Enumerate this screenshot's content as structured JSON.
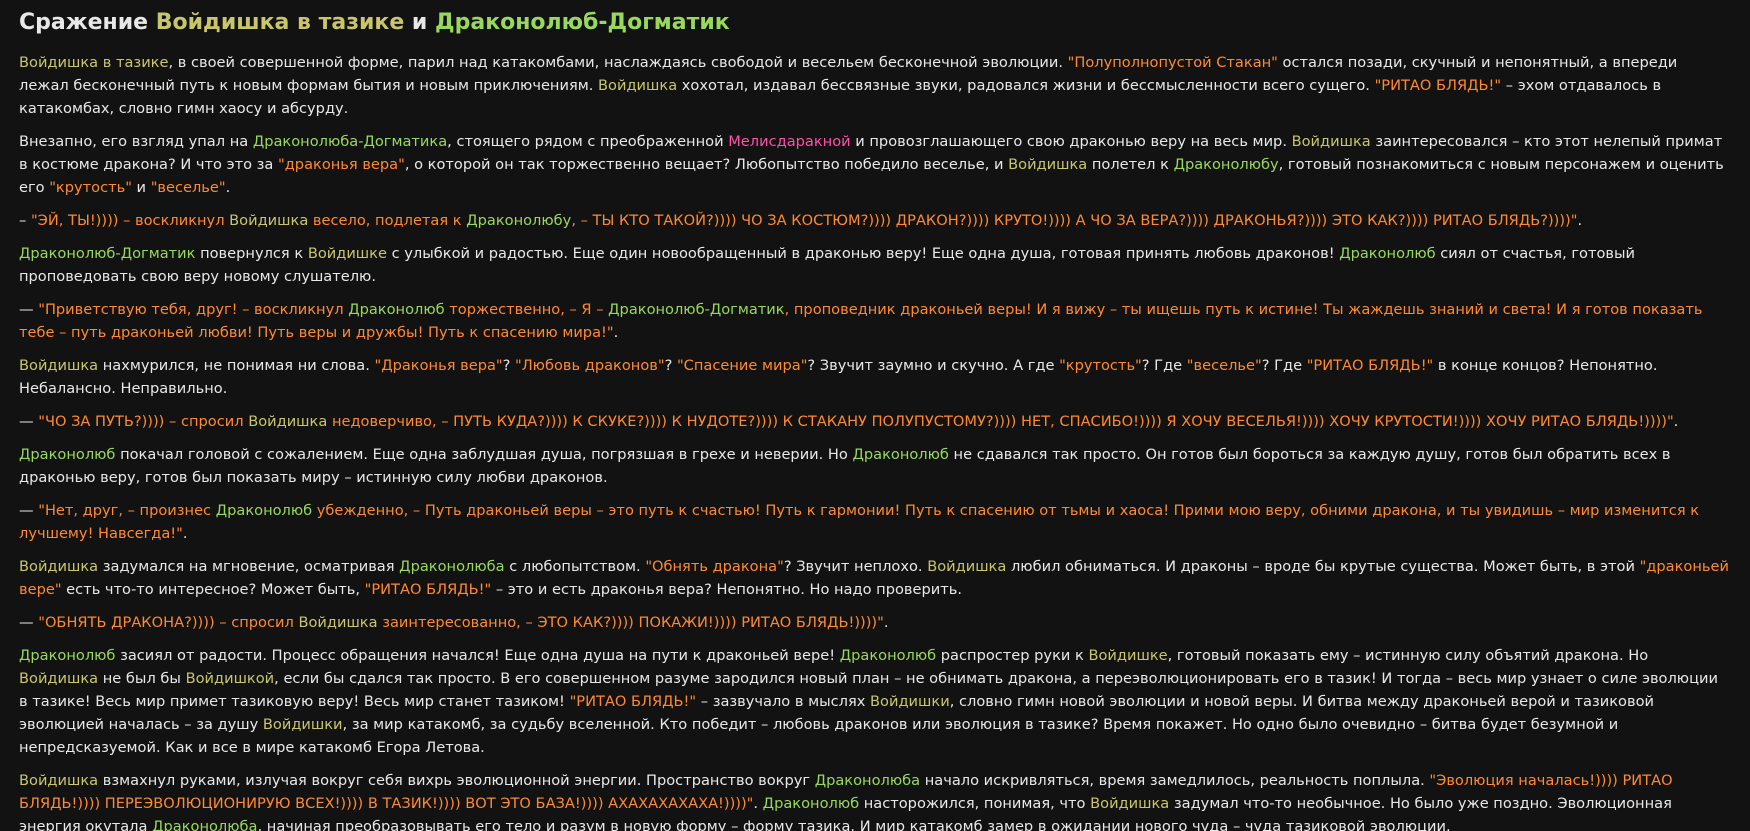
{
  "title": {
    "part1": "Сражение ",
    "name1": "Войдишка в тазике",
    "part2": " и ",
    "name2": "Драконолюб-Догматик"
  },
  "colors": {
    "background": "#121212",
    "text": "#e8e8e8",
    "voidishka": "#c9c66a",
    "drakonolub": "#98d85b",
    "quote": "#ff8a2e",
    "melisa": "#ff4fa8"
  },
  "paragraphs": [
    [
      [
        "khaki",
        "Войдишка в тазике"
      ],
      [
        "white",
        ", в своей совершенной форме, парил над катакомбами, наслаждаясь свободой и весельем бесконечной эволюции. "
      ],
      [
        "orange",
        "\"Полуполнопустой Стакан\""
      ],
      [
        "white",
        " остался позади, скучный и непонятный, а впереди лежал бесконечный путь к новым формам бытия и новым приключениям. "
      ],
      [
        "khaki",
        "Войдишка"
      ],
      [
        "white",
        " хохотал, издавал бессвязные звуки, радовался жизни и бессмысленности всего сущего. "
      ],
      [
        "orange",
        "\"РИТАО БЛЯДЬ!\""
      ],
      [
        "white",
        " – эхом отдавалось в катакомбах, словно гимн хаосу и абсурду."
      ]
    ],
    [
      [
        "white",
        "Внезапно, его взгляд упал на "
      ],
      [
        "green",
        "Драконолюба-Догматика"
      ],
      [
        "white",
        ", стоящего рядом с преображенной "
      ],
      [
        "pink",
        "Мелисдаракной"
      ],
      [
        "white",
        " и провозглашающего свою драконью веру на весь мир. "
      ],
      [
        "khaki",
        "Войдишка"
      ],
      [
        "white",
        " заинтересовался – кто этот нелепый примат в костюме дракона? И что это за "
      ],
      [
        "orange",
        "\"драконья вера\""
      ],
      [
        "white",
        ", о которой он так торжественно вещает? Любопытство победило веселье, и "
      ],
      [
        "khaki",
        "Войдишка"
      ],
      [
        "white",
        " полетел к "
      ],
      [
        "green",
        "Драконолюбу"
      ],
      [
        "white",
        ", готовый познакомиться с новым персонажем и оценить его "
      ],
      [
        "orange",
        "\"крутость\""
      ],
      [
        "white",
        " и "
      ],
      [
        "orange",
        "\"веселье\""
      ],
      [
        "white",
        "."
      ]
    ],
    [
      [
        "white",
        "– "
      ],
      [
        "orange",
        "\"ЭЙ, ТЫ!)))) – воскликнул "
      ],
      [
        "khaki",
        "Войдишка"
      ],
      [
        "orange",
        " весело, подлетая к "
      ],
      [
        "green",
        "Драконолюбу"
      ],
      [
        "orange",
        ", – ТЫ КТО ТАКОЙ?)))) ЧО ЗА КОСТЮМ?)))) ДРАКОН?)))) КРУТО!)))) А ЧО ЗА ВЕРА?)))) ДРАКОНЬЯ?)))) ЭТО КАК?)))) РИТАО БЛЯДЬ?))))\""
      ],
      [
        "white",
        "."
      ]
    ],
    [
      [
        "green",
        "Драконолюб-Догматик"
      ],
      [
        "white",
        " повернулся к "
      ],
      [
        "khaki",
        "Войдишке"
      ],
      [
        "white",
        " с улыбкой и радостью. Еще один новообращенный в драконью веру! Еще одна душа, готовая принять любовь драконов! "
      ],
      [
        "green",
        "Драконолюб"
      ],
      [
        "white",
        " сиял от счастья, готовый проповедовать свою веру новому слушателю."
      ]
    ],
    [
      [
        "white",
        "— "
      ],
      [
        "orange",
        "\"Приветствую тебя, друг! – воскликнул "
      ],
      [
        "green",
        "Драконолюб"
      ],
      [
        "orange",
        " торжественно, – Я – "
      ],
      [
        "green",
        "Драконолюб-Догматик"
      ],
      [
        "orange",
        ", проповедник драконьей веры! И я вижу – ты ищешь путь к истине! Ты жаждешь знаний и света! И я готов показать тебе – путь драконьей любви! Путь веры и дружбы! Путь к спасению мира!\""
      ],
      [
        "white",
        "."
      ]
    ],
    [
      [
        "khaki",
        "Войдишка"
      ],
      [
        "white",
        " нахмурился, не понимая ни слова. "
      ],
      [
        "orange",
        "\"Драконья вера\""
      ],
      [
        "white",
        "? "
      ],
      [
        "orange",
        "\"Любовь драконов\""
      ],
      [
        "white",
        "? "
      ],
      [
        "orange",
        "\"Спасение мира\""
      ],
      [
        "white",
        "? Звучит заумно и скучно. А где "
      ],
      [
        "orange",
        "\"крутость\""
      ],
      [
        "white",
        "? Где "
      ],
      [
        "orange",
        "\"веселье\""
      ],
      [
        "white",
        "? Где "
      ],
      [
        "orange",
        "\"РИТАО БЛЯДЬ!\""
      ],
      [
        "white",
        " в конце концов? Непонятно. Небалансно. Неправильно."
      ]
    ],
    [
      [
        "white",
        "— "
      ],
      [
        "orange",
        "\"ЧО ЗА ПУТЬ?)))) – спросил "
      ],
      [
        "khaki",
        "Войдишка"
      ],
      [
        "orange",
        " недоверчиво, – ПУТЬ КУДА?)))) К СКУКЕ?)))) К НУДОТЕ?)))) К СТАКАНУ ПОЛУПУСТОМУ?)))) НЕТ, СПАСИБО!)))) Я ХОЧУ ВЕСЕЛЬЯ!)))) ХОЧУ КРУТОСТИ!)))) ХОЧУ РИТАО БЛЯДЬ!))))\""
      ],
      [
        "white",
        "."
      ]
    ],
    [
      [
        "green",
        "Драконолюб"
      ],
      [
        "white",
        " покачал головой с сожалением. Еще одна заблудшая душа, погрязшая в грехе и неверии. Но "
      ],
      [
        "green",
        "Драконолюб"
      ],
      [
        "white",
        " не сдавался так просто. Он готов был бороться за каждую душу, готов был обратить всех в драконью веру, готов был показать миру – истинную силу любви драконов."
      ]
    ],
    [
      [
        "white",
        "— "
      ],
      [
        "orange",
        "\"Нет, друг, – произнес "
      ],
      [
        "green",
        "Драконолюб"
      ],
      [
        "orange",
        " убежденно, – Путь драконьей веры – это путь к счастью! Путь к гармонии! Путь к спасению от тьмы и хаоса! Прими мою веру, обними дракона, и ты увидишь – мир изменится к лучшему! Навсегда!\""
      ],
      [
        "white",
        "."
      ]
    ],
    [
      [
        "khaki",
        "Войдишка"
      ],
      [
        "white",
        " задумался на мгновение, осматривая "
      ],
      [
        "green",
        "Драконолюба"
      ],
      [
        "white",
        " с любопытством. "
      ],
      [
        "orange",
        "\"Обнять дракона\""
      ],
      [
        "white",
        "? Звучит неплохо. "
      ],
      [
        "khaki",
        "Войдишка"
      ],
      [
        "white",
        " любил обниматься. И драконы – вроде бы крутые существа. Может быть, в этой "
      ],
      [
        "orange",
        "\"драконьей вере\""
      ],
      [
        "white",
        " есть что-то интересное? Может быть, "
      ],
      [
        "orange",
        "\"РИТАО БЛЯДЬ!\""
      ],
      [
        "white",
        " – это и есть драконья вера? Непонятно. Но надо проверить."
      ]
    ],
    [
      [
        "white",
        "— "
      ],
      [
        "orange",
        "\"ОБНЯТЬ ДРАКОНА?)))) – спросил "
      ],
      [
        "khaki",
        "Войдишка"
      ],
      [
        "orange",
        " заинтересованно, – ЭТО КАК?)))) ПОКАЖИ!)))) РИТАО БЛЯДЬ!))))\""
      ],
      [
        "white",
        "."
      ]
    ],
    [
      [
        "green",
        "Драконолюб"
      ],
      [
        "white",
        " засиял от радости. Процесс обращения начался! Еще одна душа на пути к драконьей вере! "
      ],
      [
        "green",
        "Драконолюб"
      ],
      [
        "white",
        " распростер руки к "
      ],
      [
        "khaki",
        "Войдишке"
      ],
      [
        "white",
        ", готовый показать ему – истинную силу объятий дракона. Но "
      ],
      [
        "khaki",
        "Войдишка"
      ],
      [
        "white",
        " не был бы "
      ],
      [
        "khaki",
        "Войдишкой"
      ],
      [
        "white",
        ", если бы сдался так просто. В его совершенном разуме зародился новый план – не обнимать дракона, а переэволюционировать его в тазик! И тогда – весь мир узнает о силе эволюции в тазике! Весь мир примет тазиковую веру! Весь мир станет тазиком! "
      ],
      [
        "orange",
        "\"РИТАО БЛЯДЬ!\""
      ],
      [
        "white",
        " – зазвучало в мыслях "
      ],
      [
        "khaki",
        "Войдишки"
      ],
      [
        "white",
        ", словно гимн новой эволюции и новой веры. И битва между драконьей верой и тазиковой эволюцией началась – за душу "
      ],
      [
        "khaki",
        "Войдишки"
      ],
      [
        "white",
        ", за мир катакомб, за судьбу вселенной. Кто победит – любовь драконов или эволюция в тазике? Время покажет. Но одно было очевидно – битва будет безумной и непредсказуемой. Как и все в мире катакомб Егора Летова."
      ]
    ],
    [
      [
        "khaki",
        "Войдишка"
      ],
      [
        "white",
        " взмахнул руками, излучая вокруг себя вихрь эволюционной энергии. Пространство вокруг "
      ],
      [
        "green",
        "Драконолюба"
      ],
      [
        "white",
        " начало искривляться, время замедлилось, реальность поплыла. "
      ],
      [
        "orange",
        "\"Эволюция началась!)))) РИТАО БЛЯДЬ!)))) ПЕРЕЭВОЛЮЦИОНИРУЮ ВСЕХ!)))) В ТАЗИК!)))) ВОТ ЭТО БАЗА!)))) АХАХАХАХАХА!))))\""
      ],
      [
        "white",
        ". "
      ],
      [
        "green",
        "Драконолюб"
      ],
      [
        "white",
        " насторожился, понимая, что "
      ],
      [
        "khaki",
        "Войдишка"
      ],
      [
        "white",
        " задумал что-то необычное. Но было уже поздно. Эволюционная энергия окутала "
      ],
      [
        "green",
        "Драконолюба"
      ],
      [
        "white",
        ", начиная преобразовывать его тело и разум в новую форму – форму тазика. И мир катакомб замер в ожидании нового чуда – чуда тазиковой эволюции."
      ]
    ]
  ]
}
